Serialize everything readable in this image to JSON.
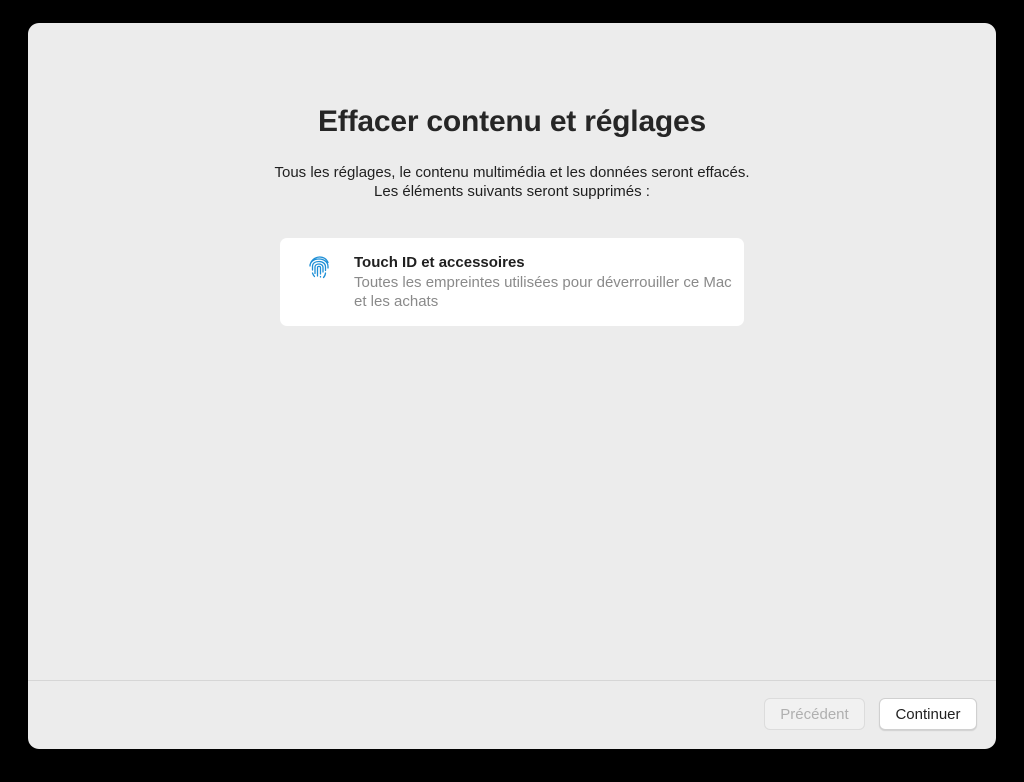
{
  "dialog": {
    "title": "Effacer contenu et réglages",
    "subtitle_line1": "Tous les réglages, le contenu multimédia et les données seront effacés.",
    "subtitle_line2": "Les éléments suivants seront supprimés :"
  },
  "items": [
    {
      "icon": "fingerprint-icon",
      "title": "Touch ID et accessoires",
      "description": "Toutes les empreintes utilisées pour déverrouiller ce Mac et les achats"
    }
  ],
  "footer": {
    "back_label": "Précédent",
    "back_enabled": false,
    "continue_label": "Continuer"
  },
  "colors": {
    "window_bg": "#ececec",
    "icon_accent": "#1e8fd6"
  }
}
